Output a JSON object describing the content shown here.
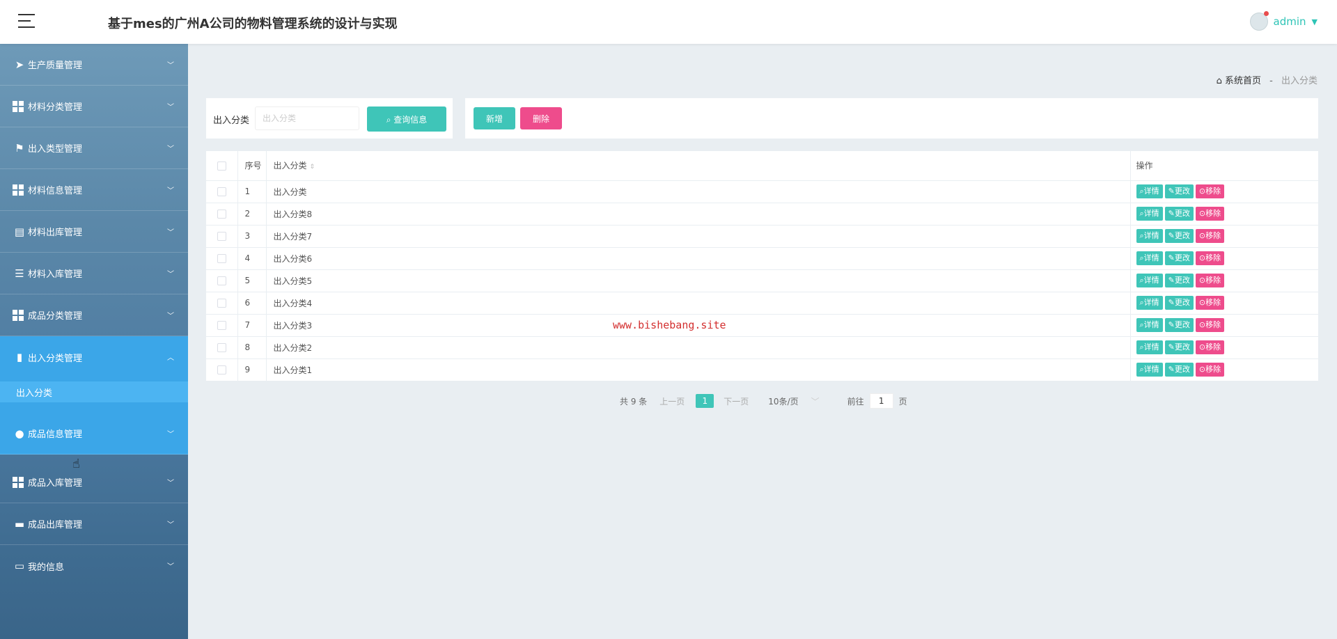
{
  "header": {
    "title": "基于mes的广州A公司的物料管理系统的设计与实现",
    "username": "admin"
  },
  "sidebar": {
    "items": [
      {
        "label": "生产质量管理",
        "icon": "paper-plane-icon"
      },
      {
        "label": "材料分类管理",
        "icon": "grid-icon"
      },
      {
        "label": "出入类型管理",
        "icon": "flag-icon"
      },
      {
        "label": "材料信息管理",
        "icon": "grid-icon"
      },
      {
        "label": "材料出库管理",
        "icon": "clipboard-icon"
      },
      {
        "label": "材料入库管理",
        "icon": "sliders-icon"
      },
      {
        "label": "成品分类管理",
        "icon": "grid-icon"
      },
      {
        "label": "出入分类管理",
        "icon": "bar-chart-icon"
      },
      {
        "label": "成品信息管理",
        "icon": "lightbulb-icon"
      },
      {
        "label": "成品入库管理",
        "icon": "grid-icon"
      },
      {
        "label": "成品出库管理",
        "icon": "comment-icon"
      },
      {
        "label": "我的信息",
        "icon": "id-card-icon"
      }
    ],
    "submenu_item": "出入分类"
  },
  "breadcrumb": {
    "home": "系统首页",
    "separator": "-",
    "current": "出入分类"
  },
  "search": {
    "label": "出入分类",
    "placeholder": "出入分类",
    "button": "查询信息"
  },
  "actions": {
    "add": "新增",
    "delete": "删除"
  },
  "table": {
    "headers": {
      "no": "序号",
      "name": "出入分类",
      "op": "操作"
    },
    "ops": {
      "detail": "详情",
      "edit": "更改",
      "remove": "移除"
    },
    "rows": [
      {
        "no": "1",
        "name": "出入分类"
      },
      {
        "no": "2",
        "name": "出入分类8"
      },
      {
        "no": "3",
        "name": "出入分类7"
      },
      {
        "no": "4",
        "name": "出入分类6"
      },
      {
        "no": "5",
        "name": "出入分类5"
      },
      {
        "no": "6",
        "name": "出入分类4"
      },
      {
        "no": "7",
        "name": "出入分类3"
      },
      {
        "no": "8",
        "name": "出入分类2"
      },
      {
        "no": "9",
        "name": "出入分类1"
      }
    ]
  },
  "watermark": "www.bishebang.site",
  "pagination": {
    "total": "共 9 条",
    "prev": "上一页",
    "page": "1",
    "next": "下一页",
    "size": "10条/页",
    "goto_label": "前往",
    "goto_value": "1",
    "goto_suffix": "页"
  },
  "colors": {
    "accent": "#3fc5b8",
    "danger": "#ee4c8c",
    "sidebar_active": "#3ba6e8"
  }
}
